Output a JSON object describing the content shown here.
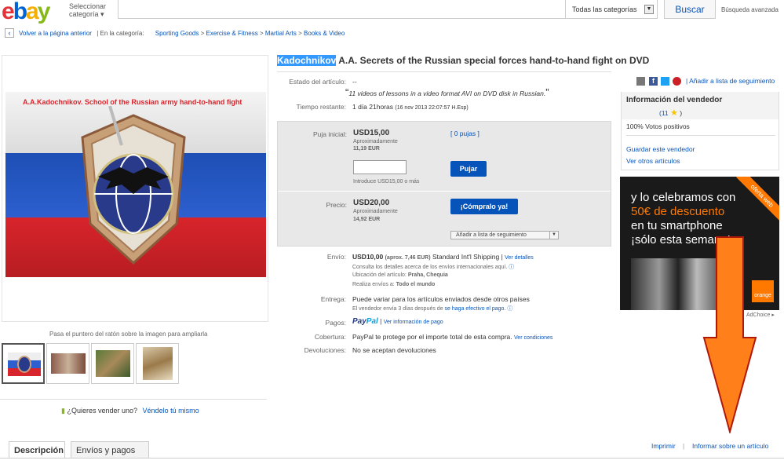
{
  "header": {
    "logo": {
      "e": "e",
      "b": "b",
      "a": "a",
      "y": "y"
    },
    "category_select": "Seleccionar categoría",
    "all_categories": "Todas las categorías",
    "search_button": "Buscar",
    "advanced_search": "Búsqueda avanzada"
  },
  "breadcrumb": {
    "back": "Volver a la página anterior",
    "in_category": "| En la categoría:",
    "items": [
      "Sporting Goods",
      "Exercise & Fitness",
      "Martial Arts",
      "Books & Video"
    ]
  },
  "gallery": {
    "image_text": "A.A.Kadochnikov. School of the Russian army hand-to-hand fight",
    "caption": "Pasa el puntero del ratón sobre la imagen para ampliarla"
  },
  "sell": {
    "prompt": "¿Quieres vender uno?",
    "link": "Véndelo tú mismo"
  },
  "tabs": {
    "description": "Descripción",
    "shipping": "Envíos y pagos"
  },
  "item": {
    "title_highlight": "Kadochnikov",
    "title_rest": "A.A. Secrets of the Russian special forces hand-to-hand fight on DVD",
    "condition_label": "Estado del artículo:",
    "condition_value": "--",
    "condition_quote": "11 videos of lessons in a video format AVI on DVD disk in Russian.",
    "time_label": "Tiempo restante:",
    "time_value": "1 día 21horas",
    "time_detail": "(16 nov 2013  22:07:57 H.Esp)"
  },
  "bid": {
    "label": "Puja inicial:",
    "price": "USD15,00",
    "approx": "Aproximadamente",
    "approx_value": "11,19 EUR",
    "count_link": "[ 0 pujas ]",
    "button": "Pujar",
    "hint": "Introduce USD15,00 o más"
  },
  "buy": {
    "label": "Precio:",
    "price": "USD20,00",
    "approx": "Aproximadamente",
    "approx_value": "14,92 EUR",
    "button": "¡Cómpralo ya!",
    "watch": "Añadir a lista de seguimiento"
  },
  "shipping": {
    "envio_label": "Envío:",
    "envio_price": "USD10,00",
    "envio_approx": "(aprox. 7,46 EUR)",
    "envio_method": "Standard Int'l Shipping",
    "envio_details": "Ver detalles",
    "envio_line2": "Consulta los detalles acerca de los envíos internacionales aquí.",
    "location_label": "Ubicación del artículo:",
    "location_value": "Praha, Chequia",
    "ships_label": "Realiza envíos a:",
    "ships_value": "Todo el mundo",
    "entrega_label": "Entrega:",
    "entrega_value": "Puede variar para los artículos enviados desde otros países",
    "entrega_line2": "El vendedor envía 3 días después de",
    "entrega_link": "se haga efectivo el pago.",
    "pagos_label": "Pagos:",
    "paypal_pay": "Pay",
    "paypal_pal": "Pal",
    "pagos_link": "Ver información de pago",
    "cobertura_label": "Cobertura:",
    "cobertura_value": "PayPal te protege por el importe total de esta compra.",
    "cobertura_link": "Ver condiciones",
    "devoluciones_label": "Devoluciones:",
    "devoluciones_value": "No se aceptan devoluciones"
  },
  "right": {
    "watchlist": "Añadir a lista de seguimiento",
    "seller_title": "Información del vendedor",
    "feedback_count": "(11",
    "feedback_close": ")",
    "positive": "100% Votos positivos",
    "save_seller": "Guardar este vendedor",
    "other_items": "Ver otros artículos",
    "ad_line1": "y lo celebramos con",
    "ad_line2": "50€ de descuento",
    "ad_line3": "en tu smartphone",
    "ad_line4": "¡sólo esta semana!",
    "ad_badge": "oferta web",
    "ad_brand": "orange",
    "adchoices": "AdChoice",
    "print": "Imprimir",
    "report": "Informar sobre un artículo"
  },
  "colors": {
    "link": "#0654ba",
    "highlight": "#3399ff",
    "arrow": "#ff7f1a",
    "button": "#0654ba"
  }
}
